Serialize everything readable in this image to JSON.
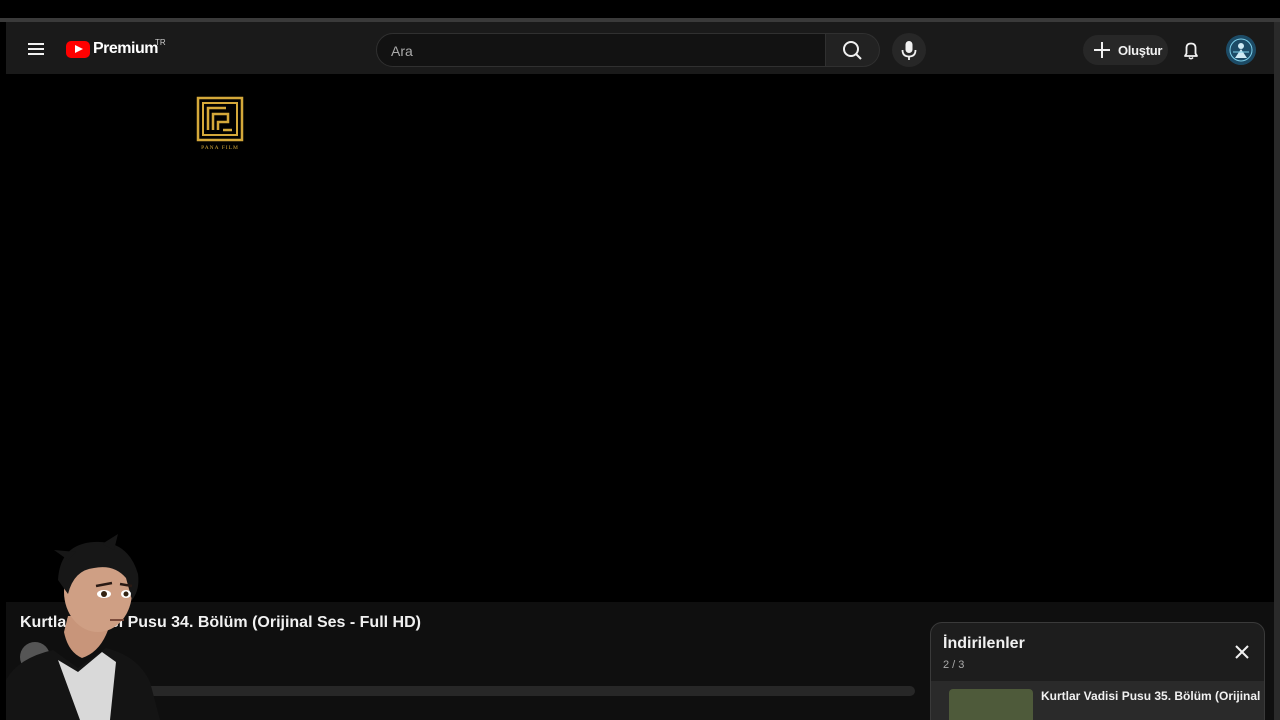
{
  "masthead": {
    "logo_text": "Premium",
    "country_code": "TR",
    "search_placeholder": "Ara",
    "create_label": "Oluştur"
  },
  "player": {
    "overlay_logo_text": "PANA FILM"
  },
  "video": {
    "title": "Kurtlar Vadisi Pusu 34. Bölüm (Orijinal Ses - Full HD)"
  },
  "playlist": {
    "title": "İndirilenler",
    "position": "2 / 3",
    "items": [
      {
        "title": "Kurtlar Vadisi Pusu 35. Bölüm (Orijinal"
      }
    ]
  },
  "colors": {
    "brand_red": "#ff0000",
    "background": "#0f0f0f",
    "masthead": "#1a1a1a",
    "pana_gold": "#d4a83a"
  }
}
